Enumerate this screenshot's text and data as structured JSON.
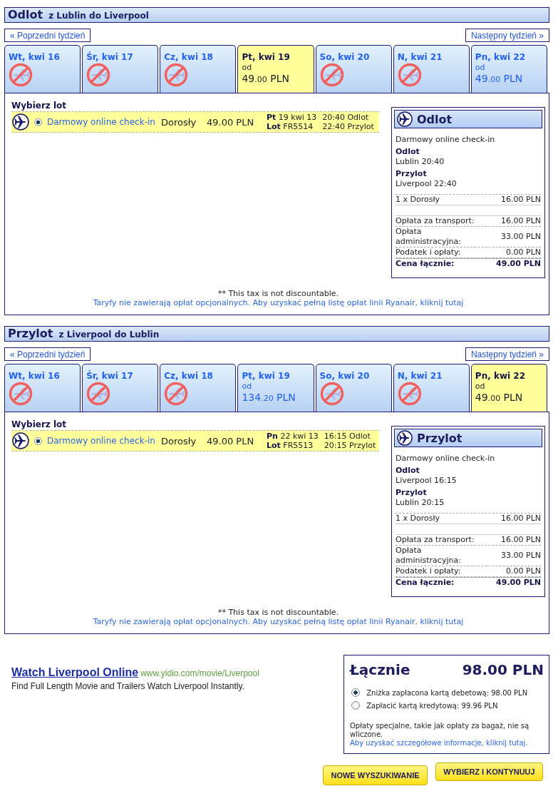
{
  "sections": [
    {
      "title": "Odlot",
      "route": "z Lublin do Liverpool",
      "prev_week": "« Poprzedni tydzień",
      "next_week": "Następny tydzień »",
      "days": [
        {
          "label": "Wt, kwi 16",
          "available": false,
          "selected": false
        },
        {
          "label": "Śr, kwi 17",
          "available": false,
          "selected": false
        },
        {
          "label": "Cz, kwi 18",
          "available": false,
          "selected": false
        },
        {
          "label": "Pt, kwi 19",
          "available": true,
          "selected": true,
          "from": "od",
          "price": {
            "whole": "49",
            "fraction": ".00",
            "currency": "PLN"
          }
        },
        {
          "label": "So, kwi 20",
          "available": false,
          "selected": false
        },
        {
          "label": "N, kwi 21",
          "available": false,
          "selected": false
        },
        {
          "label": "Pn, kwi 22",
          "available": true,
          "selected": false,
          "from": "od",
          "price": {
            "whole": "49",
            "fraction": ".00",
            "currency": "PLN"
          }
        }
      ],
      "pick_title": "Wybierz lot",
      "flight": {
        "selected": true,
        "checkin": "Darmowy online check-in",
        "passenger": "Dorosły",
        "price": "49.00 PLN",
        "date": "**Pt** 19 kwi 13",
        "flight_no": "**Lot** FR5514",
        "departure": "20:40 Odlot",
        "arrival": "22:40 Przylot"
      },
      "summary": {
        "title": "Odlot",
        "checkin": "Darmowy online check-in",
        "legs": [
          {
            "label": "Odlot",
            "value": "Lublin 20:40"
          },
          {
            "label": "Przylot",
            "value": "Liverpool 22:40"
          }
        ],
        "passengers": [
          {
            "label": "1 x Dorosły",
            "amount": "16.00 PLN"
          }
        ],
        "fees": [
          {
            "label": "Opłata za transport:",
            "amount": "16.00 PLN"
          },
          {
            "label": "Opłata administracyjna:",
            "amount": "33.00 PLN"
          },
          {
            "label": "Podatek i opłaty:",
            "amount": "0.00 PLN"
          }
        ],
        "total": {
          "label": "Cena łącznie:",
          "amount": "49.00 PLN"
        }
      },
      "tax_note": "** This tax is not discountable.",
      "fares_link": "Taryfy nie zawierają opłat opcjonalnych. Aby uzyskać pełną listę opłat linii Ryanair, kliknij tutaj"
    },
    {
      "title": "Przylot",
      "route": "z Liverpool do Lublin",
      "prev_week": "« Poprzedni tydzień",
      "next_week": "Następny tydzień »",
      "days": [
        {
          "label": "Wt, kwi 16",
          "available": false,
          "selected": false
        },
        {
          "label": "Śr, kwi 17",
          "available": false,
          "selected": false
        },
        {
          "label": "Cz, kwi 18",
          "available": false,
          "selected": false
        },
        {
          "label": "Pt, kwi 19",
          "available": true,
          "selected": false,
          "from": "od",
          "price": {
            "whole": "134",
            "fraction": ".20",
            "currency": "PLN"
          }
        },
        {
          "label": "So, kwi 20",
          "available": false,
          "selected": false
        },
        {
          "label": "N, kwi 21",
          "available": false,
          "selected": false
        },
        {
          "label": "Pn, kwi 22",
          "available": true,
          "selected": true,
          "from": "od",
          "price": {
            "whole": "49",
            "fraction": ".00",
            "currency": "PLN"
          }
        }
      ],
      "pick_title": "Wybierz lot",
      "flight": {
        "selected": true,
        "checkin": "Darmowy online check-in",
        "passenger": "Dorosły",
        "price": "49.00 PLN",
        "date": "**Pn** 22 kwi 13",
        "flight_no": "**Lot** FR5513",
        "departure": "16:15 Odlot",
        "arrival": "20:15 Przylot"
      },
      "summary": {
        "title": "Przylot",
        "checkin": "Darmowy online check-in",
        "legs": [
          {
            "label": "Odlot",
            "value": "Liverpool 16:15"
          },
          {
            "label": "Przylot",
            "value": "Lublin 20:15"
          }
        ],
        "passengers": [
          {
            "label": "1 x Dorosły",
            "amount": "16.00 PLN"
          }
        ],
        "fees": [
          {
            "label": "Opłata za transport:",
            "amount": "16.00 PLN"
          },
          {
            "label": "Opłata administracyjna:",
            "amount": "33.00 PLN"
          },
          {
            "label": "Podatek i opłaty:",
            "amount": "0.00 PLN"
          }
        ],
        "total": {
          "label": "Cena łącznie:",
          "amount": "49.00 PLN"
        }
      },
      "tax_note": "** This tax is not discountable.",
      "fares_link": "Taryfy nie zawierają opłat opcjonalnych. Aby uzyskać pełną listę opłat linii Ryanair, kliknij tutaj"
    }
  ],
  "ad": {
    "title": "Watch Liverpool Online",
    "url": "www.yidio.com/movie/Liverpool",
    "description": "Find Full Length Movie and Trailers Watch Liverpool Instantly."
  },
  "total": {
    "label": "Łącznie",
    "amount": "98.00 PLN",
    "payment_options": [
      {
        "label": "Zniżka zapłacona kartą debetową: 98.00 PLN",
        "selected": true
      },
      {
        "label": "Zapłacić kartą kredytową: 99.96 PLN",
        "selected": false
      }
    ],
    "note": "Opłaty specjalne, takie jak opłaty za bagaż, nie są wliczone.",
    "note_link": "Aby uzyskać szczegółowe informacje, kliknij tutaj."
  },
  "buttons": [
    {
      "label": "NOWE WYSZUKIWANIE"
    },
    {
      "label": "WYBIERZ I KONTYNUUJ"
    }
  ]
}
